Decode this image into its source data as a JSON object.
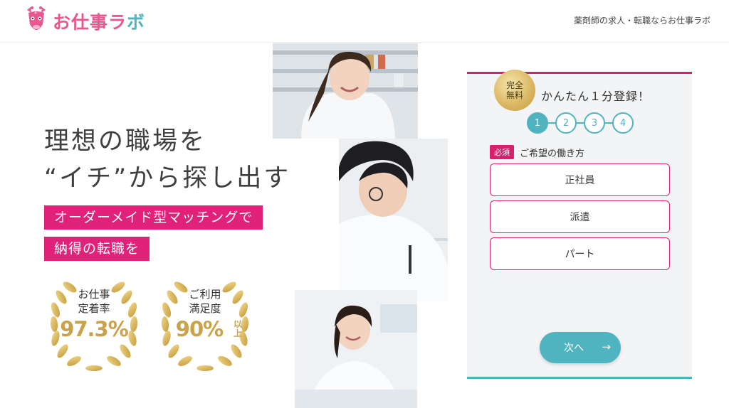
{
  "header": {
    "logo_text_main": "お仕事ラ",
    "logo_text_accent": "ボ",
    "tagline": "薬剤師の求人・転職ならお仕事ラボ"
  },
  "hero": {
    "headline_line1": "理想の職場を",
    "headline_line2": "“イチ”から探し出す",
    "band1": "オーダーメイド型マッチングで",
    "band2": "納得の転職を",
    "badges": [
      {
        "label_line1": "お仕事",
        "label_line2": "定着率",
        "value": "97.3%",
        "suffix": ""
      },
      {
        "label_line1": "ご利用",
        "label_line2": "満足度",
        "value": "90%",
        "suffix": "以上"
      }
    ]
  },
  "form": {
    "free_badge_line1": "完全",
    "free_badge_line2": "無料",
    "title": "かんたん１分登録！",
    "steps": [
      "1",
      "2",
      "3",
      "4"
    ],
    "active_step": 1,
    "required_tag": "必須",
    "question": "ご希望の働き方",
    "options": [
      "正社員",
      "派遣",
      "パート"
    ],
    "next_label": "次へ",
    "next_arrow": "→"
  },
  "colors": {
    "brand_pink": "#d6226e",
    "brand_teal": "#4fb3c0",
    "gold": "#c9a24a"
  },
  "icons": {
    "logo": "giraffe-logo-icon",
    "laurel": "laurel-wreath-icon",
    "arrow": "arrow-right-icon"
  }
}
